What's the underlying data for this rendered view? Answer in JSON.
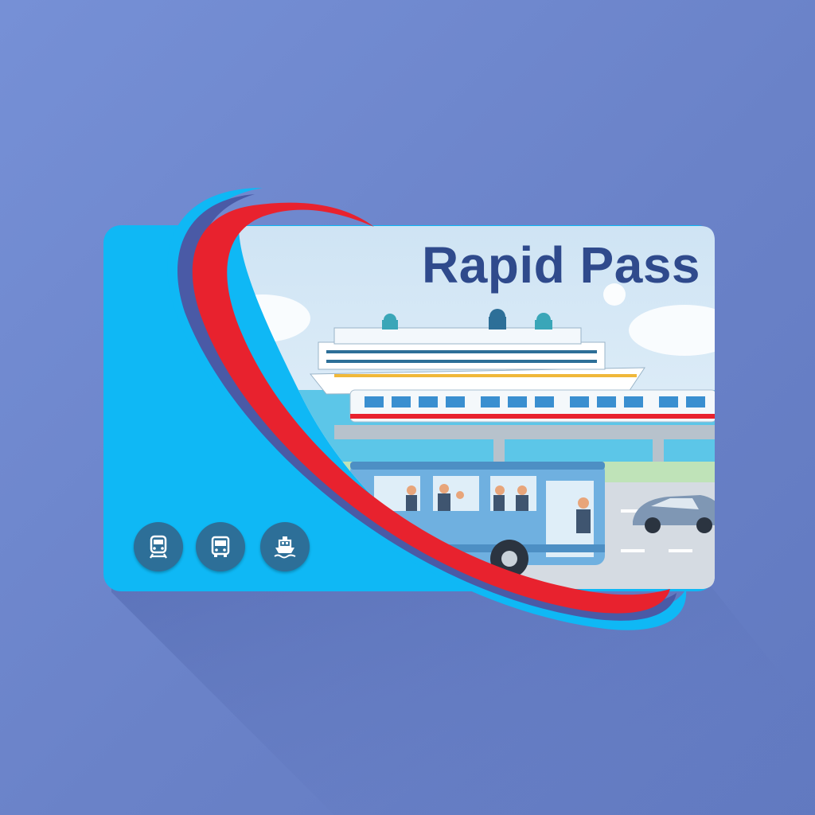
{
  "card": {
    "title": "Rapid Pass",
    "colors": {
      "background": "#6a83c8",
      "card_blue": "#0fb8f5",
      "swoosh_red": "#e8222e",
      "swoosh_outline": "#0fb8f5",
      "title": "#2f4a8c",
      "icon_badge": "#2d6f98"
    },
    "transport_icons": [
      "train-icon",
      "bus-icon",
      "ferry-icon"
    ]
  }
}
